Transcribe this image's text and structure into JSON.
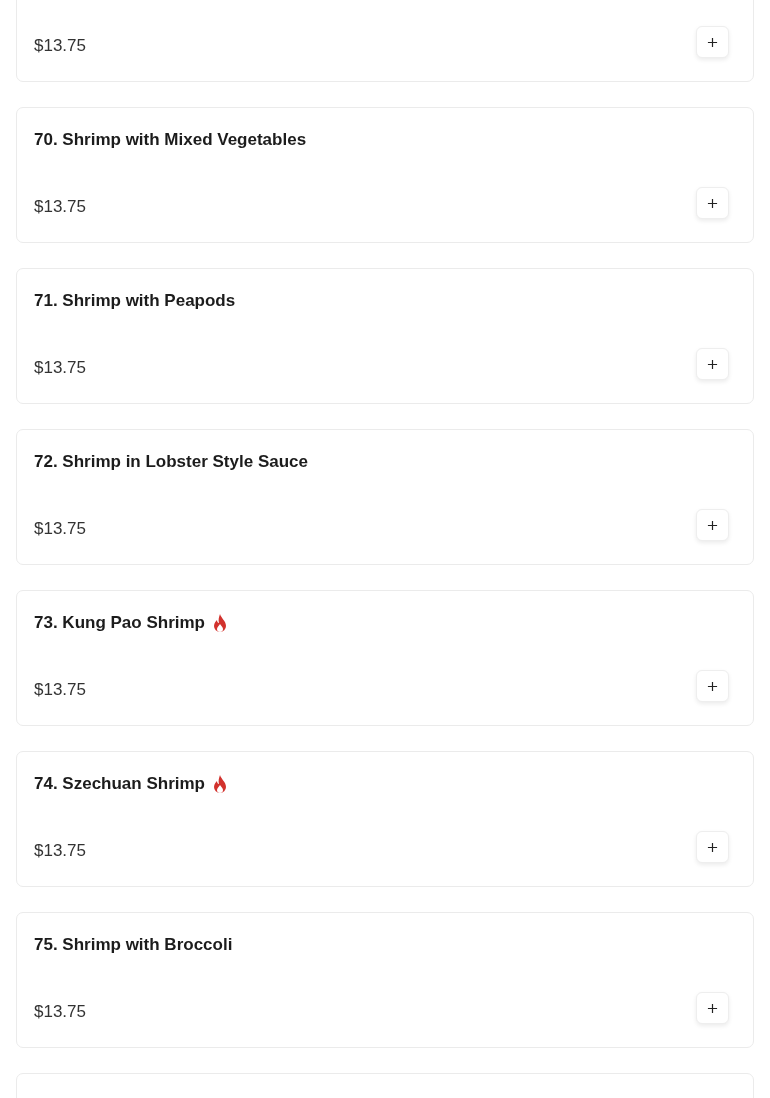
{
  "menu_items": [
    {
      "kind": "full",
      "price": "$13.75"
    },
    {
      "kind": "full",
      "title": "70. Shrimp with Mixed Vegetables",
      "price": "$13.75",
      "spicy": false
    },
    {
      "kind": "full",
      "title": "71. Shrimp with Peapods",
      "price": "$13.75",
      "spicy": false
    },
    {
      "kind": "full",
      "title": "72. Shrimp in Lobster Style Sauce",
      "price": "$13.75",
      "spicy": false
    },
    {
      "kind": "full",
      "title": "73. Kung Pao Shrimp",
      "price": "$13.75",
      "spicy": true
    },
    {
      "kind": "full",
      "title": "74. Szechuan Shrimp",
      "price": "$13.75",
      "spicy": true
    },
    {
      "kind": "full",
      "title": "75. Shrimp with Broccoli",
      "price": "$13.75",
      "spicy": false
    },
    {
      "kind": "partial"
    }
  ]
}
